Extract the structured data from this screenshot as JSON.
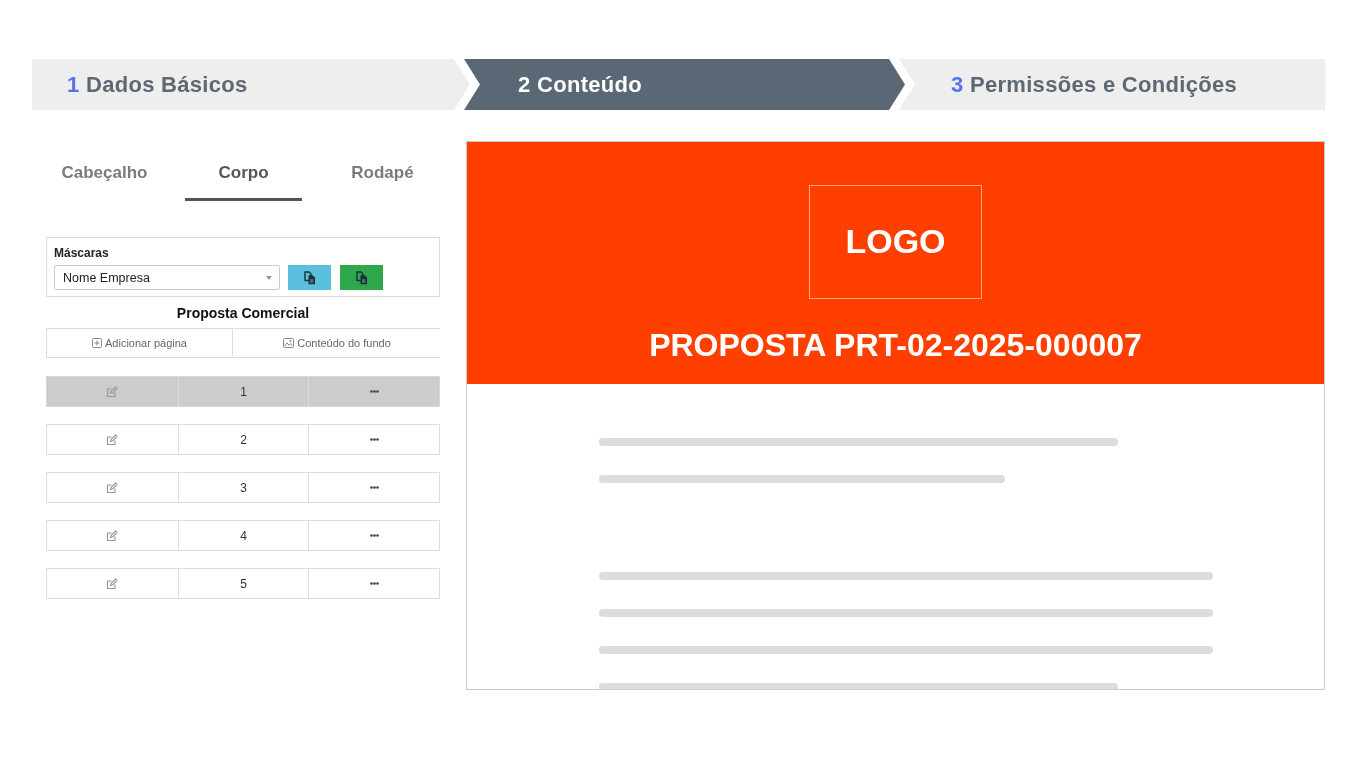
{
  "steps": [
    {
      "number": "1",
      "label": "Dados Básicos",
      "selected": false
    },
    {
      "number": "2",
      "label": "Conteúdo",
      "selected": true
    },
    {
      "number": "3",
      "label": "Permissões e Condições",
      "selected": false
    }
  ],
  "section_tabs": [
    {
      "label": "Cabeçalho",
      "selected": false
    },
    {
      "label": "Corpo",
      "selected": true
    },
    {
      "label": "Rodapé",
      "selected": false
    }
  ],
  "masks": {
    "label": "Máscaras",
    "select_value": "Nome Empresa",
    "buttons": [
      {
        "color": "#5bc0de"
      },
      {
        "color": "#2ea84a"
      }
    ]
  },
  "document_title": "Proposta Comercial",
  "actions": [
    {
      "kind": "add",
      "label": "Adicionar página"
    },
    {
      "kind": "image",
      "label": "Conteúdo do fundo"
    }
  ],
  "pages": [
    {
      "number": "1",
      "selected": true
    },
    {
      "number": "2",
      "selected": false
    },
    {
      "number": "3",
      "selected": false
    },
    {
      "number": "4",
      "selected": false
    },
    {
      "number": "5",
      "selected": false
    }
  ],
  "preview": {
    "logo": "LOGO",
    "title": "PROPOSTA PRT-02-2025-000007"
  }
}
